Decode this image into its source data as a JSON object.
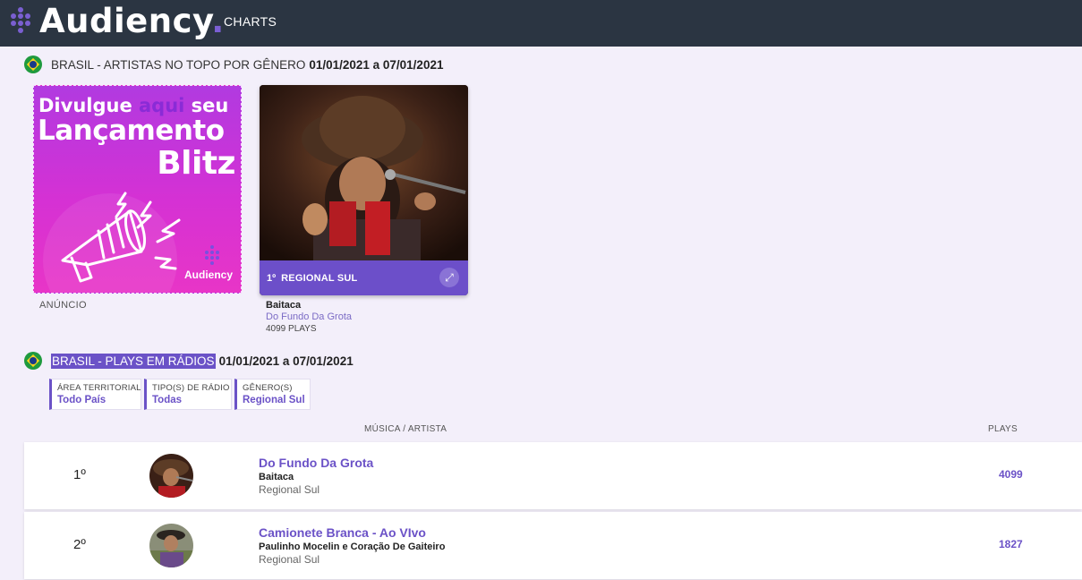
{
  "header": {
    "logo_text": "Audiency",
    "logo_dot": ".",
    "nav_charts": "CHARTS"
  },
  "section_top": {
    "title": "BRASIL - ARTISTAS NO TOPO POR GÊNERO",
    "dates": "01/01/2021 a 07/01/2021"
  },
  "ad": {
    "line1_a": "Divulgue ",
    "line1_b": "aqui",
    "line1_c": " seu",
    "line2": "Lançamento",
    "line3": "Blitz",
    "brand": "Audiency",
    "caption": "ANÚNCIO"
  },
  "artist_card": {
    "rank": "1º",
    "genre": "REGIONAL SUL",
    "artist": "Baitaca",
    "song": "Do Fundo Da Grota",
    "plays": "4099 PLAYS"
  },
  "section_radio": {
    "title": "BRASIL - PLAYS EM RÁDIOS",
    "dates": "01/01/2021 a 07/01/2021"
  },
  "filters": [
    {
      "label": "ÁREA TERRITORIAL",
      "value": "Todo País"
    },
    {
      "label": "TIPO(S) DE RÁDIO",
      "value": "Todas"
    },
    {
      "label": "GÊNERO(S)",
      "value": "Regional Sul"
    }
  ],
  "table": {
    "col_song_artist": "MÚSICA / ARTISTA",
    "col_plays": "PLAYS",
    "rows": [
      {
        "position": "1º",
        "song": "Do Fundo Da Grota",
        "artist": "Baitaca",
        "genre": "Regional Sul",
        "plays": "4099"
      },
      {
        "position": "2º",
        "song": "Camionete Branca - Ao VIvo",
        "artist": "Paulinho Mocelin e Coração De Gaiteiro",
        "genre": "Regional Sul",
        "plays": "1827"
      }
    ]
  },
  "colors": {
    "header_bg": "#2b3542",
    "accent": "#6b52c7",
    "page_bg": "#f3effa"
  }
}
